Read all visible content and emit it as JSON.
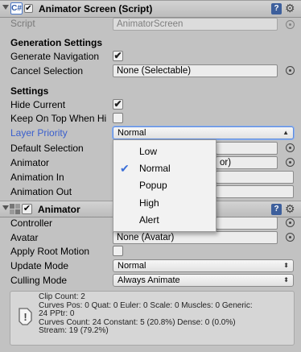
{
  "script_component": {
    "title": "Animator Screen (Script)",
    "script_label": "Script",
    "script_value": "AnimatorScreen",
    "generation_header": "Generation Settings",
    "generate_navigation_label": "Generate Navigation",
    "generate_navigation_checked": true,
    "cancel_selection_label": "Cancel Selection",
    "cancel_selection_value": "None (Selectable)",
    "settings_header": "Settings",
    "hide_current_label": "Hide Current",
    "hide_current_checked": true,
    "keep_on_top_label": "Keep On Top When Hi",
    "keep_on_top_checked": false,
    "layer_priority_label": "Layer Priority",
    "layer_priority_value": "Normal",
    "default_selection_label": "Default Selection",
    "animator_label": "Animator",
    "animator_value_partial": "or)",
    "animation_in_label": "Animation In",
    "animation_out_label": "Animation Out"
  },
  "layer_priority_popup": {
    "options": [
      "Low",
      "Normal",
      "Popup",
      "High",
      "Alert"
    ],
    "selected": "Normal"
  },
  "animator_component": {
    "title": "Animator",
    "enabled": true,
    "controller_label": "Controller",
    "avatar_label": "Avatar",
    "avatar_value": "None (Avatar)",
    "apply_root_motion_label": "Apply Root Motion",
    "apply_root_motion_checked": false,
    "update_mode_label": "Update Mode",
    "update_mode_value": "Normal",
    "culling_mode_label": "Culling Mode",
    "culling_mode_value": "Always Animate",
    "info_lines": [
      "Clip Count: 2",
      "Curves Pos: 0 Quat: 0 Euler: 0 Scale: 0 Muscles: 0 Generic:",
      "24 PPtr: 0",
      "Curves Count: 24 Constant: 5 (20.8%) Dense: 0 (0.0%)",
      "Stream: 19 (79.2%)"
    ]
  },
  "colors": {
    "panel_bg": "#c2c2c2",
    "highlight_label": "#3a5fcd",
    "selection_accent": "#3b6fd8"
  },
  "icons": [
    "script-icon",
    "help-book-icon",
    "gear-icon",
    "object-picker-icon",
    "check-icon",
    "animator-icon",
    "foldout-arrow-icon",
    "info-icon"
  ]
}
